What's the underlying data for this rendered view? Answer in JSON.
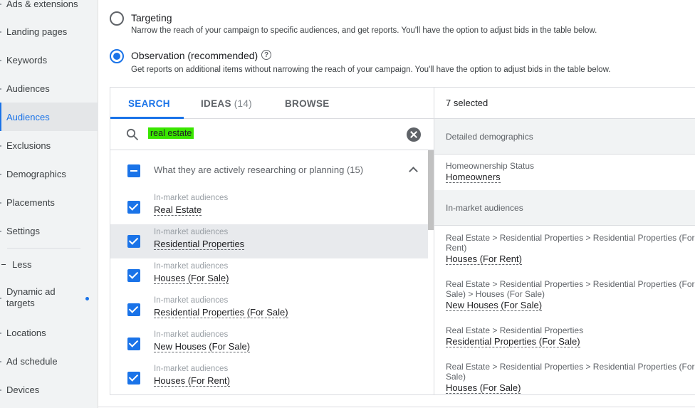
{
  "sidebar": {
    "items": [
      {
        "label": "Ads & extensions"
      },
      {
        "label": "Landing pages"
      },
      {
        "label": "Keywords"
      },
      {
        "label": "Audiences"
      },
      {
        "label": "Audiences"
      },
      {
        "label": "Exclusions"
      },
      {
        "label": "Demographics"
      },
      {
        "label": "Placements"
      },
      {
        "label": "Settings"
      },
      {
        "label": "Less"
      },
      {
        "label": "Dynamic ad targets"
      },
      {
        "label": "Locations"
      },
      {
        "label": "Ad schedule"
      },
      {
        "label": "Devices"
      }
    ]
  },
  "options": {
    "targeting": {
      "title": "Targeting",
      "desc": "Narrow the reach of your campaign to specific audiences, and get reports. You'll have the option to adjust bids in the table below."
    },
    "observation": {
      "title": "Observation (recommended)",
      "desc": "Get reports on additional items without narrowing the reach of your campaign. You'll have the option to adjust bids in the table below."
    },
    "help_glyph": "?"
  },
  "tabs": [
    {
      "label": "SEARCH",
      "count": ""
    },
    {
      "label": "IDEAS",
      "count": "(14)"
    },
    {
      "label": "BROWSE",
      "count": ""
    }
  ],
  "search": {
    "value": "real estate"
  },
  "group": {
    "label": "What they are actively researching or planning (15)"
  },
  "results": [
    {
      "category": "In-market audiences",
      "name": "Real Estate"
    },
    {
      "category": "In-market audiences",
      "name": "Residential Properties"
    },
    {
      "category": "In-market audiences",
      "name": "Houses (For Sale)"
    },
    {
      "category": "In-market audiences",
      "name": "Residential Properties (For Sale)"
    },
    {
      "category": "In-market audiences",
      "name": "New Houses (For Sale)"
    },
    {
      "category": "In-market audiences",
      "name": "Houses (For Rent)"
    }
  ],
  "selected": {
    "header": "7 selected",
    "sections": [
      {
        "label": "Detailed demographics"
      },
      {
        "label": "In-market audiences"
      }
    ],
    "items": [
      {
        "path": "Homeownership Status",
        "name": "Homeowners"
      },
      {
        "path": "Real Estate > Residential Properties > Residential Properties (For Rent)",
        "name": "Houses (For Rent)"
      },
      {
        "path": "Real Estate > Residential Properties > Residential Properties (For Sale) > Houses (For Sale)",
        "name": "New Houses (For Sale)"
      },
      {
        "path": "Real Estate > Residential Properties",
        "name": "Residential Properties (For Sale)"
      },
      {
        "path": "Real Estate > Residential Properties > Residential Properties (For Sale)",
        "name": "Houses (For Sale)"
      }
    ]
  },
  "colors": {
    "accent": "#1a73e8",
    "search_highlight": "#39e600"
  }
}
